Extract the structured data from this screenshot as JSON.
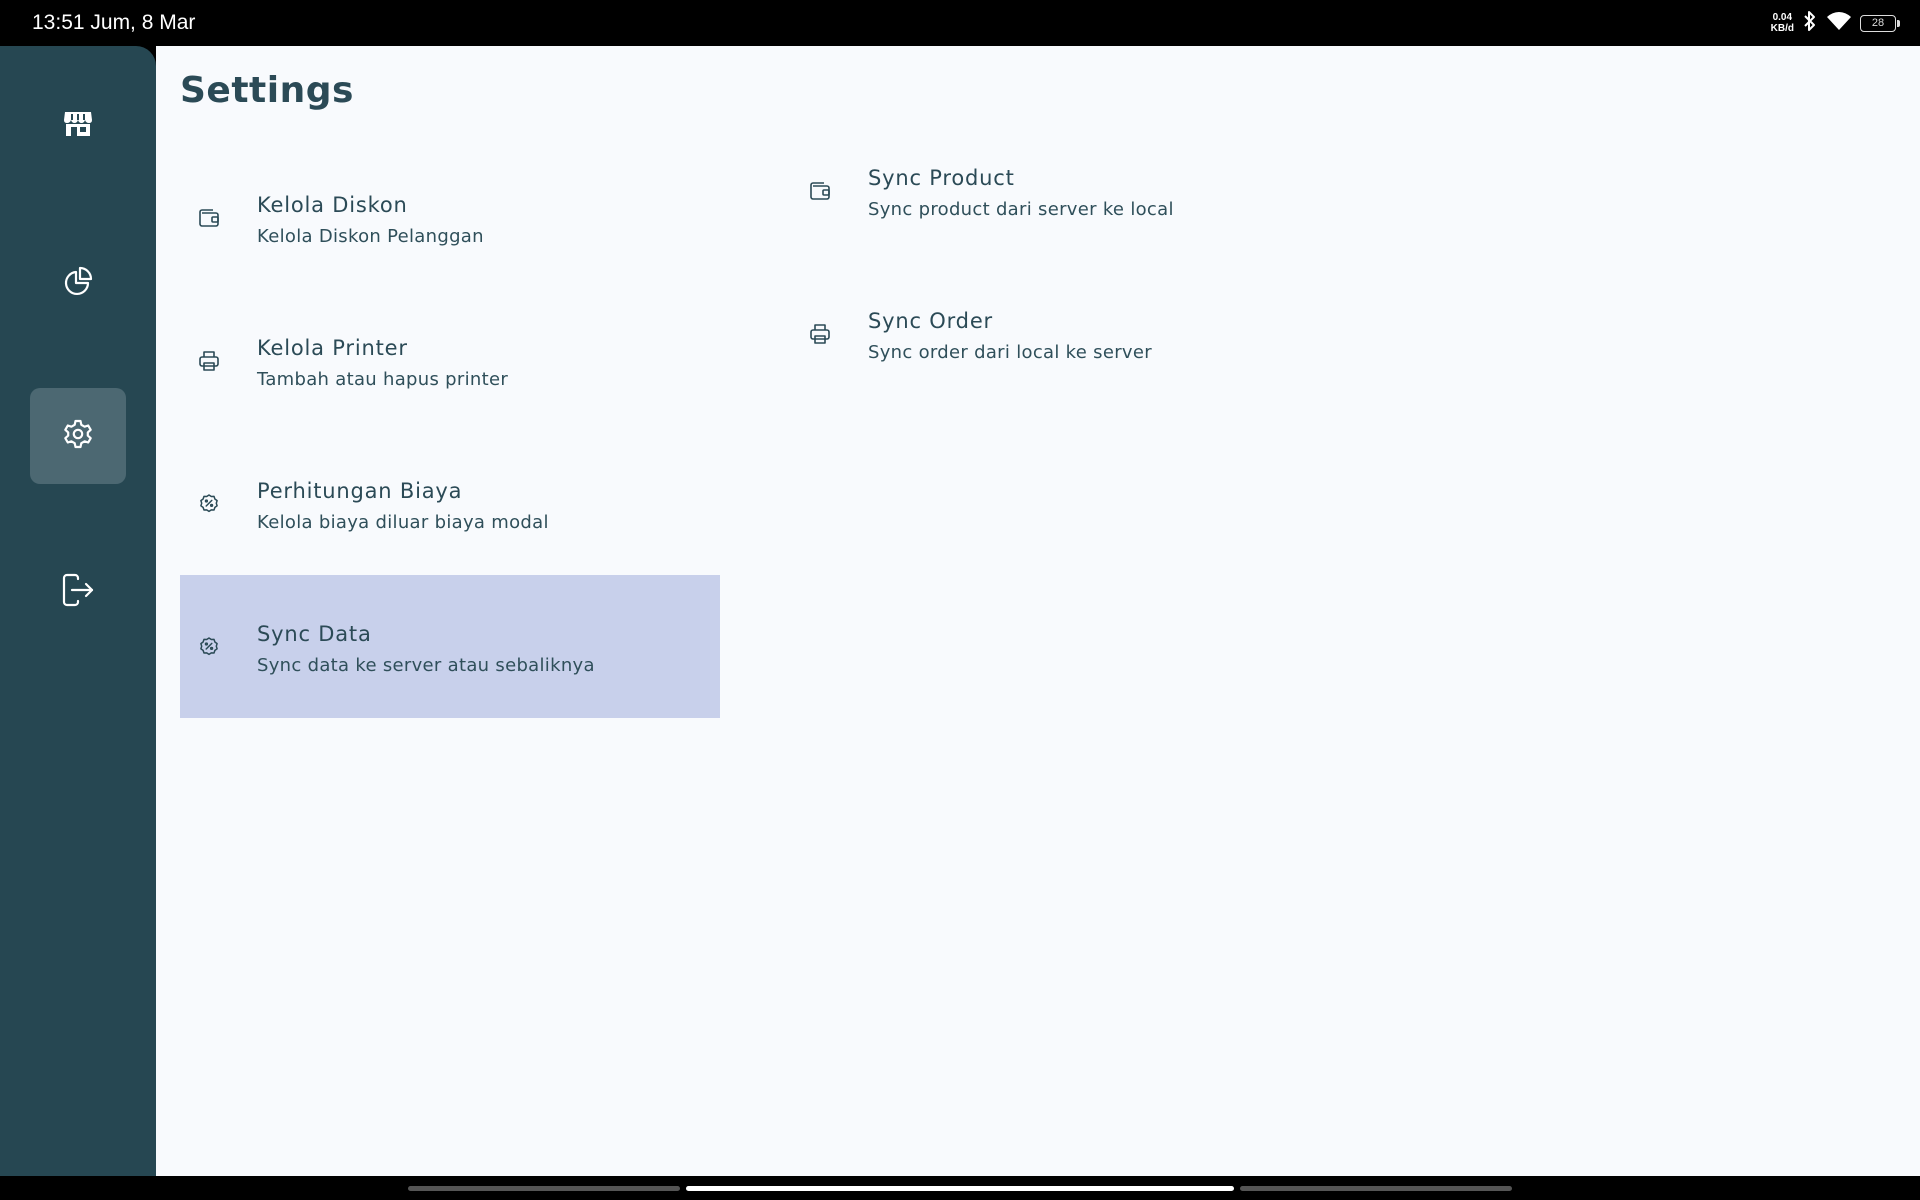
{
  "status_bar": {
    "time": "13:51 Jum, 8 Mar",
    "net_speed_value": "0.04",
    "net_speed_unit": "KB/d",
    "battery": "28"
  },
  "sidebar": {
    "items": [
      {
        "name": "store",
        "icon": "store-icon",
        "active": false
      },
      {
        "name": "report",
        "icon": "pie-chart-icon",
        "active": false
      },
      {
        "name": "settings",
        "icon": "gear-icon",
        "active": true
      },
      {
        "name": "logout",
        "icon": "logout-icon",
        "active": false
      }
    ]
  },
  "page": {
    "title": "Settings"
  },
  "settings": {
    "left": [
      {
        "title": "Kelola Diskon",
        "subtitle": "Kelola Diskon Pelanggan",
        "icon": "wallet-icon"
      },
      {
        "title": "Kelola Printer",
        "subtitle": "Tambah atau hapus printer",
        "icon": "printer-icon"
      },
      {
        "title": "Perhitungan Biaya",
        "subtitle": "Kelola biaya diluar biaya modal",
        "icon": "discount-badge-icon"
      },
      {
        "title": "Sync Data",
        "subtitle": "Sync data ke server atau sebaliknya",
        "icon": "discount-badge-icon",
        "selected": true
      }
    ],
    "right": [
      {
        "title": "Sync Product",
        "subtitle": "Sync product dari server ke local",
        "icon": "wallet-icon"
      },
      {
        "title": "Sync Order",
        "subtitle": "Sync order dari local ke server",
        "icon": "printer-icon"
      }
    ]
  },
  "colors": {
    "sidebar_bg": "#264752",
    "sidebar_active": "#4c6872",
    "main_bg": "#f8fafd",
    "selected_bg": "#c8d0eb",
    "text_primary": "#2b4a56"
  }
}
